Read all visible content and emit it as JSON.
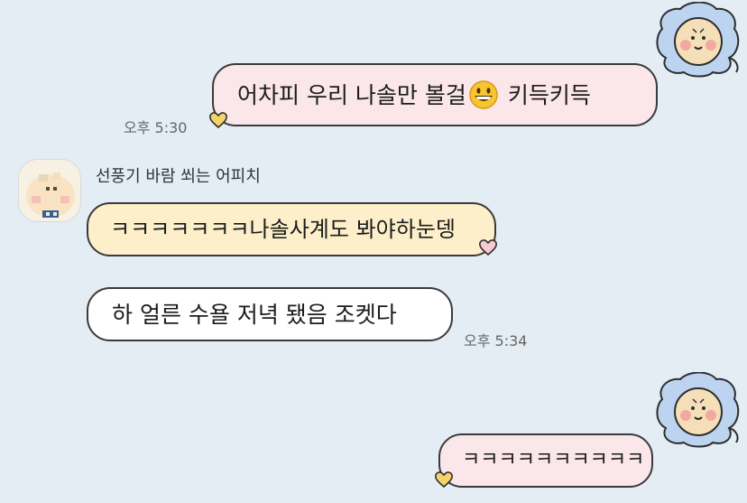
{
  "messages": [
    {
      "text_before": "어차피 우리 나솔만 볼걸",
      "emoji": "grinning-face",
      "text_after": "키득키득",
      "time": "오후 5:30"
    },
    {
      "sender": "선풍기 바람 쐬는 어피치",
      "text": "ㅋㅋㅋㅋㅋㅋㅋ나솔사계도 봐야하눈뎅"
    },
    {
      "text": "하 얼른 수욜 저녁 됐음 조켓다",
      "time": "오후 5:34"
    },
    {
      "text": "ㅋㅋㅋㅋㅋㅋㅋㅋㅋㅋ"
    }
  ],
  "colors": {
    "background": "#e4ecf4",
    "my_bubble": "#fbe6ea",
    "peer_bubble_yellow": "#fcefc9",
    "peer_bubble_white": "#ffffff",
    "heart": "#f5d36a"
  },
  "icons": [
    "lion-avatar-icon",
    "heart-icon",
    "grinning-face-emoji-icon",
    "peach-avatar-icon"
  ]
}
